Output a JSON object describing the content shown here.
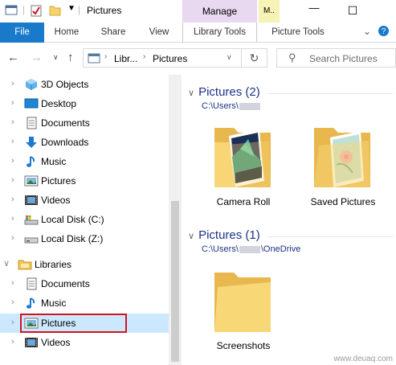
{
  "window": {
    "title": "Pictures",
    "context_tab_manage": "Manage",
    "context_tab_m": "M..",
    "minimize": "—",
    "maximize": "☐"
  },
  "ribbon": {
    "tabs": [
      "File",
      "Home",
      "Share",
      "View",
      "Library Tools",
      "Picture Tools"
    ]
  },
  "address": {
    "crumbs": [
      "Libr...",
      "Pictures"
    ],
    "search_placeholder": "Search Pictures"
  },
  "nav": {
    "items": [
      {
        "label": "3D Objects",
        "icon": "3d-objects-icon"
      },
      {
        "label": "Desktop",
        "icon": "desktop-icon"
      },
      {
        "label": "Documents",
        "icon": "documents-icon"
      },
      {
        "label": "Downloads",
        "icon": "downloads-icon"
      },
      {
        "label": "Music",
        "icon": "music-icon"
      },
      {
        "label": "Pictures",
        "icon": "pictures-icon"
      },
      {
        "label": "Videos",
        "icon": "videos-icon"
      },
      {
        "label": "Local Disk (C:)",
        "icon": "drive-c-icon"
      },
      {
        "label": "Local Disk (Z:)",
        "icon": "drive-z-icon"
      },
      {
        "label": "Libraries",
        "icon": "libraries-icon"
      },
      {
        "label": "Documents",
        "icon": "documents-icon"
      },
      {
        "label": "Music",
        "icon": "music-icon"
      },
      {
        "label": "Pictures",
        "icon": "pictures-icon"
      },
      {
        "label": "Videos",
        "icon": "videos-icon"
      }
    ]
  },
  "groups": [
    {
      "title": "Pictures (2)",
      "path_prefix": "C:\\Users\\",
      "path_suffix": "",
      "folders": [
        "Camera Roll",
        "Saved Pictures"
      ]
    },
    {
      "title": "Pictures (1)",
      "path_prefix": "C:\\Users\\",
      "path_suffix": "\\OneDrive",
      "folders": [
        "Screenshots"
      ]
    }
  ],
  "watermark": "www.deuaq.com",
  "colors": {
    "accent": "#1979ca",
    "selection": "#cce8ff",
    "highlight_box": "#d0141c",
    "group_heading": "#1e3287"
  }
}
